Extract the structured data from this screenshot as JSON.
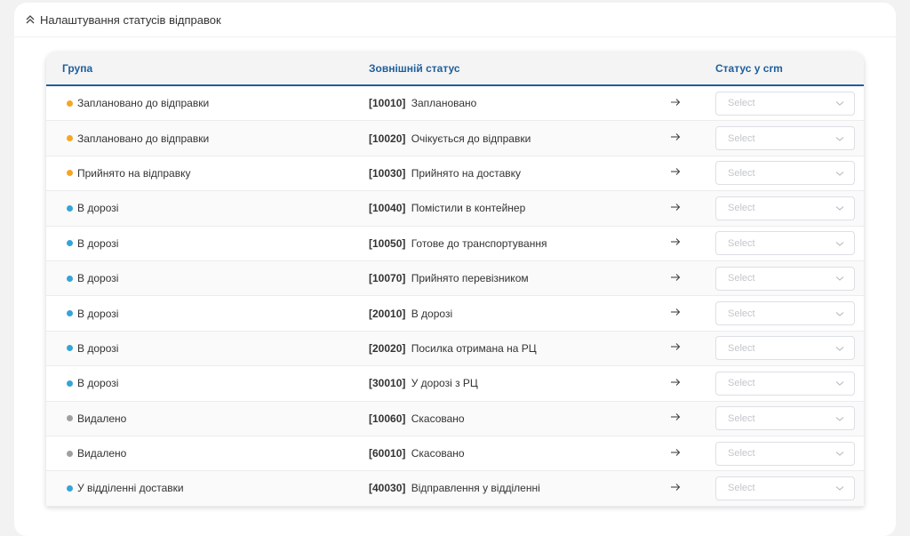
{
  "header": {
    "title": "Налаштування статусів відправок"
  },
  "table": {
    "columns": {
      "group": "Група",
      "external": "Зовнішній статус",
      "crm": "Статус у crm"
    },
    "select_placeholder": "Select",
    "group_colors": {
      "orange": "#f5a623",
      "blue": "#35a4d8",
      "gray": "#a0a0a0"
    },
    "rows": [
      {
        "group": "Заплановано до відправки",
        "color": "orange",
        "code": "[10010]",
        "status": "Заплановано"
      },
      {
        "group": "Заплановано до відправки",
        "color": "orange",
        "code": "[10020]",
        "status": "Очікується до відправки"
      },
      {
        "group": "Прийнято на відправку",
        "color": "orange",
        "code": "[10030]",
        "status": "Прийнято на доставку"
      },
      {
        "group": "В дорозі",
        "color": "blue",
        "code": "[10040]",
        "status": "Помістили в контейнер"
      },
      {
        "group": "В дорозі",
        "color": "blue",
        "code": "[10050]",
        "status": "Готове до транспортування"
      },
      {
        "group": "В дорозі",
        "color": "blue",
        "code": "[10070]",
        "status": "Прийнято перевізником"
      },
      {
        "group": "В дорозі",
        "color": "blue",
        "code": "[20010]",
        "status": "В дорозі"
      },
      {
        "group": "В дорозі",
        "color": "blue",
        "code": "[20020]",
        "status": "Посилка отримана на РЦ"
      },
      {
        "group": "В дорозі",
        "color": "blue",
        "code": "[30010]",
        "status": "У дорозі з РЦ"
      },
      {
        "group": "Видалено",
        "color": "gray",
        "code": "[10060]",
        "status": "Скасовано"
      },
      {
        "group": "Видалено",
        "color": "gray",
        "code": "[60010]",
        "status": "Скасовано"
      },
      {
        "group": "У відділенні доставки",
        "color": "blue",
        "code": "[40030]",
        "status": "Відправлення у відділенні"
      }
    ]
  }
}
